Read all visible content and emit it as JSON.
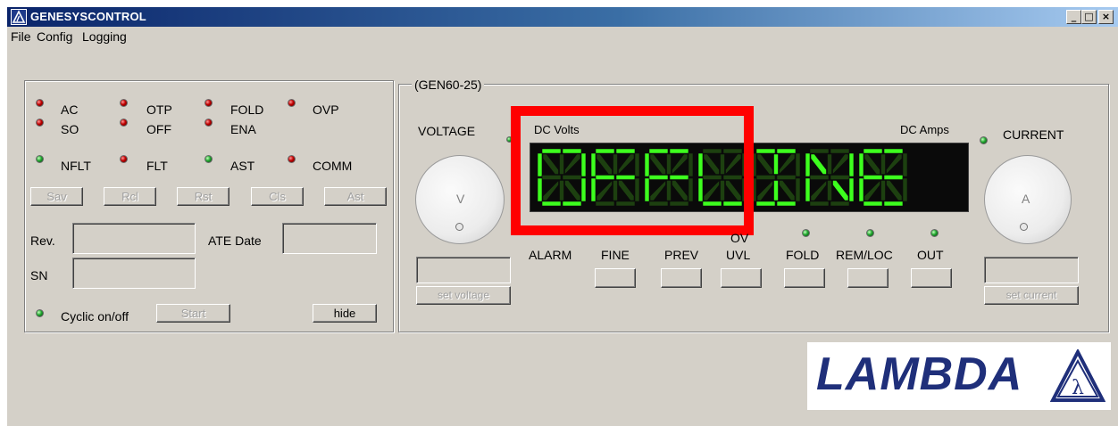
{
  "window": {
    "title": "GENESYSCONTROL",
    "controls": {
      "minimize": "_",
      "maximize": "□",
      "close": "×"
    }
  },
  "menubar": {
    "items": [
      "File",
      "Config",
      "Logging"
    ]
  },
  "status_panel": {
    "indicators": [
      {
        "label": "AC",
        "color": "red"
      },
      {
        "label": "OTP",
        "color": "red"
      },
      {
        "label": "FOLD",
        "color": "red"
      },
      {
        "label": "OVP",
        "color": "red"
      },
      {
        "label": "SO",
        "color": "red"
      },
      {
        "label": "OFF",
        "color": "red"
      },
      {
        "label": "ENA",
        "color": "red"
      },
      {
        "label": "NFLT",
        "color": "green"
      },
      {
        "label": "FLT",
        "color": "red"
      },
      {
        "label": "AST",
        "color": "green"
      },
      {
        "label": "COMM",
        "color": "red"
      }
    ],
    "buttons": [
      "Sav",
      "Rcl",
      "Rst",
      "Cls",
      "Ast"
    ],
    "rev_label": "Rev.",
    "ate_date_label": "ATE Date",
    "sn_label": "SN",
    "cyclic_label": "Cyclic on/off",
    "start_button": "Start",
    "hide_button": "hide"
  },
  "supply_panel": {
    "group_title": "(GEN60-25)",
    "voltage_label": "VOLTAGE",
    "current_label": "CURRENT",
    "dc_volts_label": "DC Volts",
    "dc_amps_label": "DC Amps",
    "voltage_knob_letter": "V",
    "current_knob_letter": "A",
    "display_text": "OFF LINE",
    "set_voltage_button": "set voltage",
    "set_current_button": "set current",
    "switch_labels": [
      "ALARM",
      "FINE",
      "PREV",
      "UVL",
      "FOLD",
      "REM/LOC",
      "OUT"
    ],
    "uvl_overlabel": "OV",
    "highlight_color": "#ff0000"
  },
  "logo": {
    "text": "LAMBDA",
    "symbol": "λ"
  },
  "colors": {
    "face": "#d4d0c8",
    "title_start": "#0a246a",
    "display_on": "#3dff1e",
    "display_off": "#1d4010",
    "logo_blue": "#1f2f7a"
  }
}
